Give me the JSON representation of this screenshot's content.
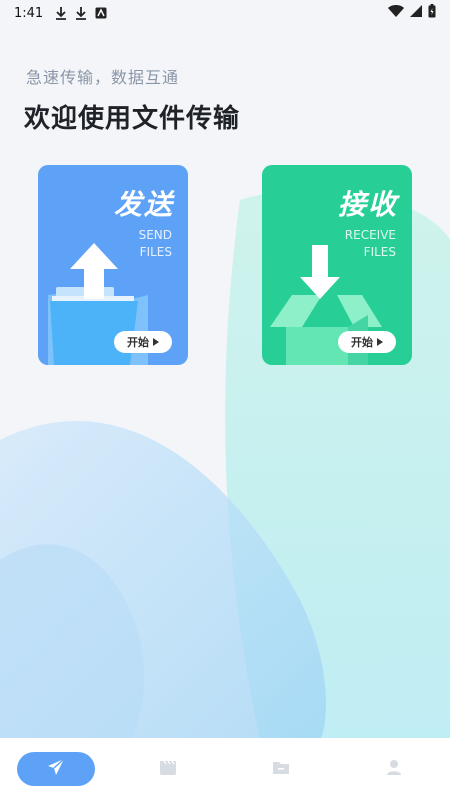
{
  "status_bar": {
    "time": "1:41"
  },
  "header": {
    "subtitle": "急速传输，数据互通",
    "title": "欢迎使用文件传输"
  },
  "cards": {
    "send": {
      "title": "发送",
      "en_line1": "SEND",
      "en_line2": "FILES",
      "button": "开始",
      "color": "#5ea2f7"
    },
    "receive": {
      "title": "接收",
      "en_line1": "RECEIVE",
      "en_line2": "FILES",
      "button": "开始",
      "color": "#27cf97"
    }
  },
  "tabs": [
    {
      "icon": "send-icon",
      "active": true
    },
    {
      "icon": "clapperboard-icon",
      "active": false
    },
    {
      "icon": "folder-icon",
      "active": false
    },
    {
      "icon": "person-icon",
      "active": false
    }
  ]
}
